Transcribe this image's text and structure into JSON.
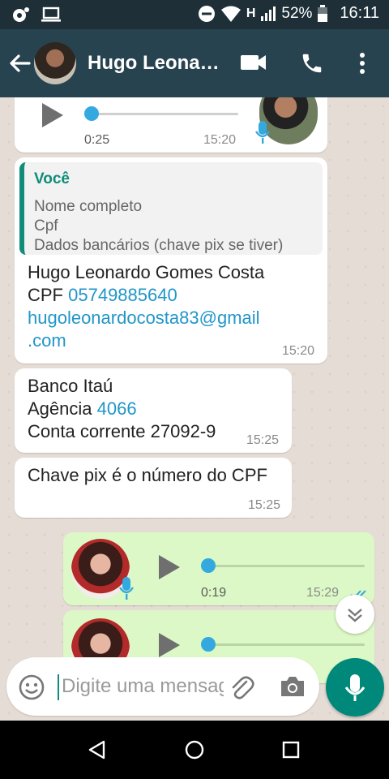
{
  "status": {
    "battery": "52%",
    "time": "16:11",
    "network": "H"
  },
  "contact": {
    "name": "Hugo Leonardo Gomes Costa"
  },
  "messages": {
    "m1": {
      "duration": "0:25",
      "time": "15:20",
      "progress": 0.0
    },
    "m2": {
      "quote_author": "Você",
      "quote_lines": [
        "Nome completo",
        "Cpf",
        "Dados bancários (chave pix se tiver)"
      ],
      "name_line": "Hugo Leonardo Gomes Costa",
      "cpf_label": "CPF",
      "cpf_value": "05749885640",
      "email_part1": "hugoleonardocosta83@gmail",
      "email_part2": ".com",
      "time": "15:20"
    },
    "m3": {
      "line1": "Banco Itaú",
      "agencia_label": "Agência",
      "agencia_value": "4066",
      "line3": "Conta corrente 27092-9",
      "time": "15:25"
    },
    "m4": {
      "text": "Chave pix é o número do CPF",
      "time": "15:25"
    },
    "m5": {
      "duration": "0:19",
      "time": "15:29",
      "read": true,
      "progress": 0.0
    },
    "m6": {
      "progress": 0.0
    }
  },
  "input": {
    "placeholder": "Digite uma mensagem"
  },
  "colors": {
    "header": "#27434f",
    "accent": "#00897b",
    "outgoing": "#dcf8c6",
    "link": "#2196c9"
  },
  "icons": [
    "back-arrow-icon",
    "video-call-icon",
    "phone-icon",
    "more-vert-icon",
    "mic-icon",
    "emoji-icon",
    "attach-icon",
    "camera-icon",
    "chevron-down-icon"
  ]
}
